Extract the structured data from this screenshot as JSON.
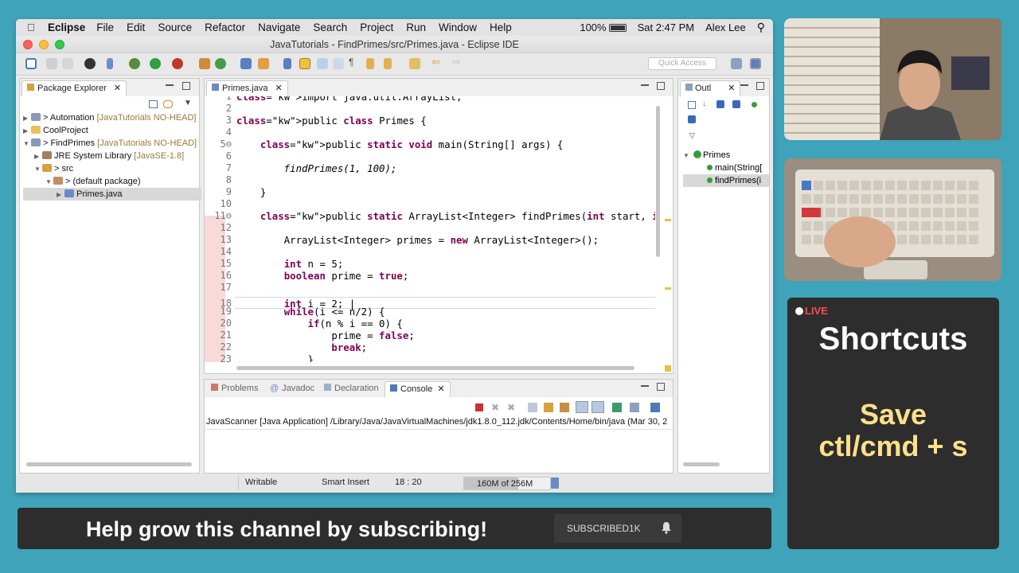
{
  "menubar": {
    "app": "Eclipse",
    "items": [
      "File",
      "Edit",
      "Source",
      "Refactor",
      "Navigate",
      "Search",
      "Project",
      "Run",
      "Window",
      "Help"
    ],
    "battery": "100%",
    "time": "Sat 2:47 PM",
    "user": "Alex Lee"
  },
  "window": {
    "title": "JavaTutorials - FindPrimes/src/Primes.java - Eclipse IDE"
  },
  "toolbar": {
    "quick_access": "Quick Access"
  },
  "package_explorer": {
    "tab": "Package Explorer",
    "rows": [
      {
        "name": "> Automation",
        "suffix": " [JavaTutorials NO-HEAD]"
      },
      {
        "name": "CoolProject",
        "suffix": ""
      },
      {
        "name": "> FindPrimes",
        "suffix": " [JavaTutorials NO-HEAD]"
      },
      {
        "name": "JRE System Library",
        "suffix": " [JavaSE-1.8]"
      },
      {
        "name": "> src",
        "suffix": ""
      },
      {
        "name": "> (default package)",
        "suffix": ""
      },
      {
        "name": "Primes.java",
        "suffix": ""
      }
    ]
  },
  "editor": {
    "tab": "Primes.java",
    "lines": [
      {
        "n": "1",
        "t": "import java.util.ArrayList;"
      },
      {
        "n": "2",
        "t": ""
      },
      {
        "n": "3",
        "t": "public class Primes {"
      },
      {
        "n": "4",
        "t": ""
      },
      {
        "n": "5⊖",
        "t": "    public static void main(String[] args) {"
      },
      {
        "n": "6",
        "t": ""
      },
      {
        "n": "7",
        "t": "        findPrimes(1, 100);"
      },
      {
        "n": "8",
        "t": ""
      },
      {
        "n": "9",
        "t": "    }"
      },
      {
        "n": "10",
        "t": ""
      },
      {
        "n": "11⊖",
        "t": "    public static ArrayList<Integer> findPrimes(int start, int end)"
      },
      {
        "n": "12",
        "t": ""
      },
      {
        "n": "13",
        "t": "        ArrayList<Integer> primes = new ArrayList<Integer>();"
      },
      {
        "n": "14",
        "t": ""
      },
      {
        "n": "15",
        "t": "        int n = 5;"
      },
      {
        "n": "16",
        "t": "        boolean prime = true;"
      },
      {
        "n": "17",
        "t": ""
      },
      {
        "n": "18",
        "t": "        int i = 2; |"
      },
      {
        "n": "19",
        "t": "        while(i <= n/2) {"
      },
      {
        "n": "20",
        "t": "            if(n % i == 0) {"
      },
      {
        "n": "21",
        "t": "                prime = false;"
      },
      {
        "n": "22",
        "t": "                break;"
      },
      {
        "n": "23",
        "t": "            }"
      }
    ]
  },
  "outline": {
    "tab": "Outl",
    "rows": [
      {
        "label": "Primes"
      },
      {
        "label": "main(String["
      },
      {
        "label": "findPrimes(i"
      }
    ]
  },
  "bottom_panel": {
    "tabs": [
      "Problems",
      "Javadoc",
      "Declaration",
      "Console"
    ],
    "console_header": "JavaScanner [Java Application] /Library/Java/JavaVirtualMachines/jdk1.8.0_112.jdk/Contents/Home/bin/java (Mar 30, 2"
  },
  "status": {
    "writable": "Writable",
    "insert": "Smart Insert",
    "position": "18 : 20",
    "heap": "160M of 256M",
    "heap_used_fraction": 0.625
  },
  "overlay": {
    "live_label": "LIVE",
    "shortcut_title": "Shortcuts",
    "shortcut_line1": "Save",
    "shortcut_line2": "ctl/cmd + s",
    "banner_text": "Help grow this channel by subscribing!",
    "subscribed_label": "SUBSCRIBED",
    "subscriber_count": "1K",
    "accent_color": "#ffe08a",
    "live_color": "#ff4b4b"
  }
}
